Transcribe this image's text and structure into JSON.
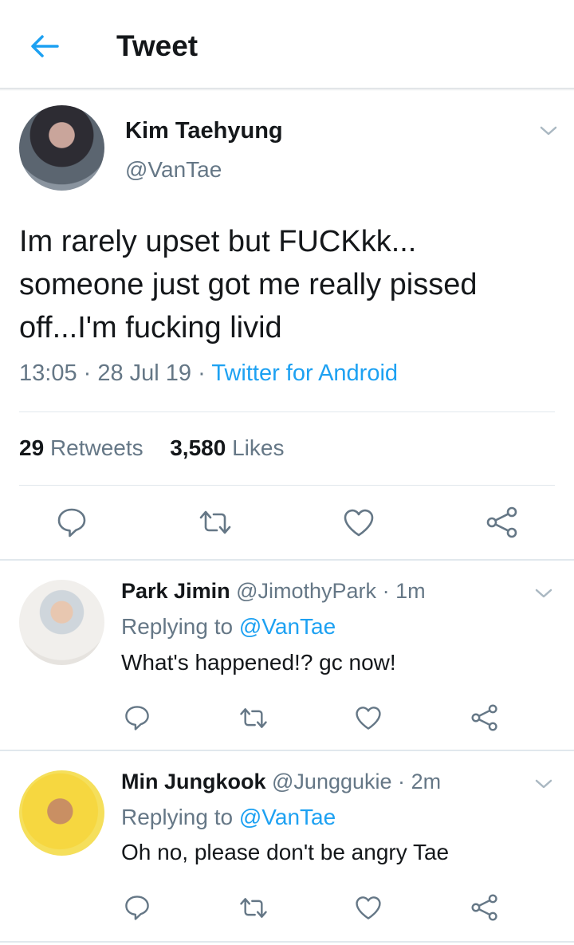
{
  "header": {
    "title": "Tweet"
  },
  "tweet": {
    "name": "Kim Taehyung",
    "handle": "@VanTae",
    "text": "Im rarely upset but FUCKkk...\nsomeone just got me really pissed\noff...I'm fucking livid",
    "time": "13:05",
    "date": "28 Jul 19",
    "source": "Twitter for Android",
    "retweets_count": "29",
    "retweets_label": "Retweets",
    "likes_count": "3,580",
    "likes_label": "Likes"
  },
  "replies": [
    {
      "name": "Park Jimin",
      "handle": "@JimothyPark",
      "time": "1m",
      "replying_label": "Replying to",
      "replying_to": "@VanTae",
      "text": "What's happened!? gc now!"
    },
    {
      "name": "Min Jungkook",
      "handle": "@Junggukie",
      "time": "2m",
      "replying_label": "Replying to",
      "replying_to": "@VanTae",
      "text": "Oh no, please don't be angry Tae"
    }
  ],
  "colors": {
    "accent": "#1da1f2",
    "secondary_text": "#657786",
    "divider": "#e1e8ed"
  },
  "icons": [
    "back-arrow-icon",
    "chevron-down-icon",
    "reply-icon",
    "retweet-icon",
    "like-icon",
    "share-icon"
  ]
}
